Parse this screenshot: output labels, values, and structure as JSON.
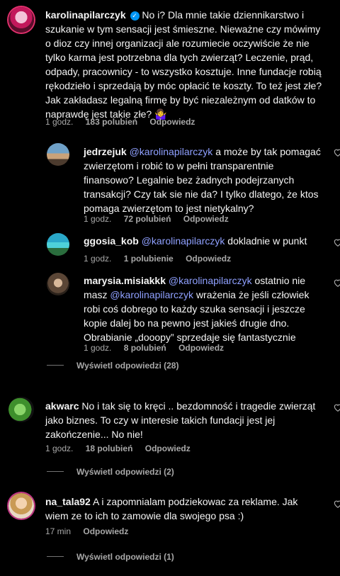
{
  "comments": [
    {
      "username": "karolinapilarczyk",
      "verified": true,
      "text": "No i? Dla mnie takie dziennikarstwo i szukanie w tym sensacji jest śmieszne. Nieważne czy mówimy o dioz czy innej organizacji ale rozumiecie oczywiście że nie tylko karma jest potrzebna dla tych zwierząt? Leczenie, prąd, odpady, pracownicy - to wszystko kosztuje. Inne fundacje robią rękodzieło i sprzedają by móc opłacić te koszty. To też jest złe? Jak zakładasz legalną firmę by być niezależnym od datków to naprawdę jest takie złe? 🤷‍♀️",
      "time": "1 godz.",
      "likes": "183 polubień",
      "reply": "Odpowiedz",
      "avatar_icon": "profile-photo"
    },
    {
      "username": "jedrzejuk",
      "mention": "@karolinapilarczyk",
      "text": "a może by tak pomagać zwierzętom i robić to w pełni transparentnie finansowo? Legalnie bez żadnych podejrzanych transakcji? Czy tak sie nie da? I tylko dlatego, że ktos pomaga zwierzętom to jest nietykalny?",
      "time": "1 godz.",
      "likes": "72 polubień",
      "reply": "Odpowiedz",
      "avatar_icon": "profile-photo"
    },
    {
      "username": "ggosia_kob",
      "mention": "@karolinapilarczyk",
      "text": "dokladnie w punkt",
      "time": "1 godz.",
      "likes": "1 polubienie",
      "reply": "Odpowiedz",
      "avatar_icon": "profile-photo"
    },
    {
      "username": "marysia.misiakkk",
      "mention": "@karolinapilarczyk",
      "text_a": "ostatnio nie masz",
      "mention2": "@karolinapilarczyk",
      "text_b": "wrażenia że jeśli człowiek robi coś dobrego to każdy szuka sensacji i jeszcze kopie dalej bo na pewno jest jakieś drugie dno. Obrabianie „dooopy” sprzedaje się fantastycznie",
      "time": "1 godz.",
      "likes": "8 polubień",
      "reply": "Odpowiedz",
      "avatar_icon": "profile-photo"
    },
    {
      "username": "akwarc",
      "text": "No i tak się to kręci .. bezdomność i tragedie zwierząt jako biznes. To czy w interesie takich fundacji jest jej zakończenie... No nie!",
      "time": "1 godz.",
      "likes": "18 polubień",
      "reply": "Odpowiedz",
      "avatar_icon": "profile-photo"
    },
    {
      "username": "na_tala92",
      "text": "A i zapomnialam podziekowac za reklame. Jak wiem ze to ich to zamowie dla swojego psa :)",
      "time": "17 min",
      "reply": "Odpowiedz",
      "avatar_icon": "profile-photo"
    }
  ],
  "view_replies": [
    "Wyświetl odpowiedzi (28)",
    "Wyświetl odpowiedzi (2)",
    "Wyświetl odpowiedzi (1)"
  ],
  "colors": {
    "background": "#000000",
    "text": "#f5f5f5",
    "muted": "#a8a8a8",
    "mention": "#8fa0ff",
    "verified": "#0095f6"
  },
  "icons": {
    "like": "heart-outline-icon",
    "verified": "verified-badge-icon"
  }
}
